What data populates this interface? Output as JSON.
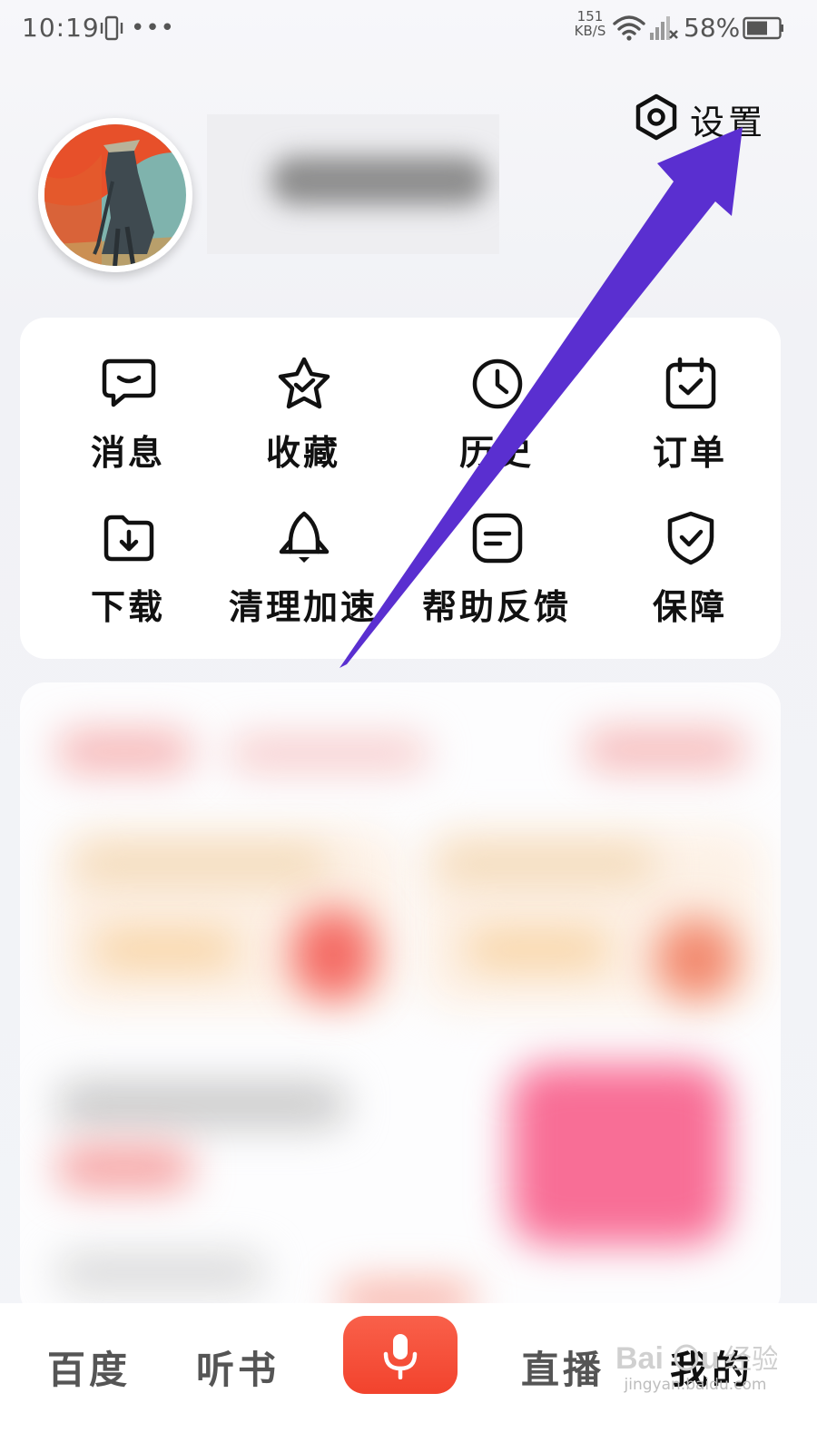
{
  "status_bar": {
    "time": "10:19",
    "network_speed_value": "151",
    "network_speed_unit": "KB/S",
    "battery": "58%"
  },
  "profile": {
    "settings_label": "设置"
  },
  "quick_actions": {
    "items": [
      {
        "label": "消息",
        "icon": "message-icon"
      },
      {
        "label": "收藏",
        "icon": "star-icon"
      },
      {
        "label": "历史",
        "icon": "clock-icon"
      },
      {
        "label": "订单",
        "icon": "calendar-check-icon"
      },
      {
        "label": "下载",
        "icon": "download-icon"
      },
      {
        "label": "清理加速",
        "icon": "rocket-icon"
      },
      {
        "label": "帮助反馈",
        "icon": "feedback-icon"
      },
      {
        "label": "保障",
        "icon": "shield-check-icon"
      }
    ]
  },
  "bottom_nav": {
    "items": [
      {
        "label": "百度"
      },
      {
        "label": "听书"
      },
      {
        "label": "直播"
      },
      {
        "label": "我的"
      }
    ],
    "mic_icon": "microphone-icon"
  },
  "watermark": {
    "text": "jingyan.baidu.com"
  },
  "colors": {
    "accent": "#f2432d",
    "annotation_arrow": "#5a2fd0"
  }
}
